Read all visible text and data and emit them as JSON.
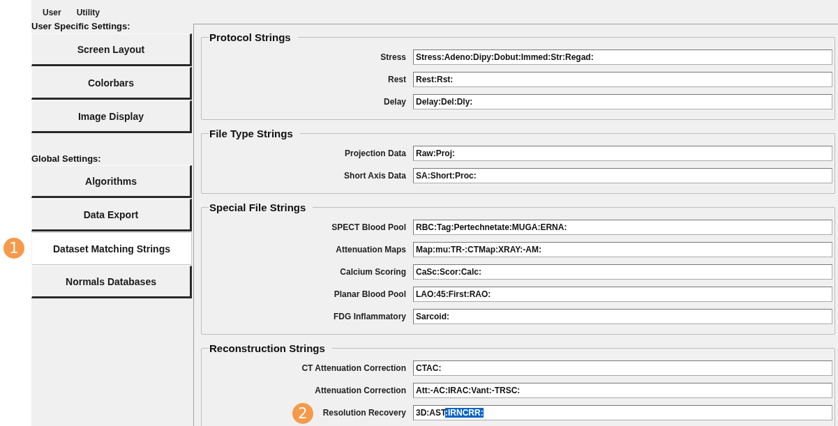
{
  "menu": [
    {
      "label": "User"
    },
    {
      "label": "Utility"
    }
  ],
  "sidebar": {
    "sections": [
      {
        "title": "User Specific Settings:",
        "buttons": [
          {
            "label": "Screen Layout",
            "selected": false
          },
          {
            "label": "Colorbars",
            "selected": false
          },
          {
            "label": "Image Display",
            "selected": false
          }
        ]
      },
      {
        "title": "Global Settings:",
        "buttons": [
          {
            "label": "Algorithms",
            "selected": false
          },
          {
            "label": "Data Export",
            "selected": false
          },
          {
            "label": "Dataset Matching Strings",
            "selected": true,
            "marker": "1"
          },
          {
            "label": "Normals Databases",
            "selected": false
          }
        ]
      }
    ]
  },
  "groups": [
    {
      "title": "Protocol Strings",
      "rows": [
        {
          "label": "Stress",
          "value": "Stress:Adeno:Dipy:Dobut:Immed:Str:Regad:"
        },
        {
          "label": "Rest",
          "value": "Rest:Rst:"
        },
        {
          "label": "Delay",
          "value": "Delay:Del:Dly:"
        }
      ]
    },
    {
      "title": "File Type Strings",
      "rows": [
        {
          "label": "Projection Data",
          "value": "Raw:Proj:"
        },
        {
          "label": "Short Axis Data",
          "value": "SA:Short:Proc:"
        }
      ]
    },
    {
      "title": "Special File Strings",
      "rows": [
        {
          "label": "SPECT Blood Pool",
          "value": "RBC:Tag:Pertechnetate:MUGA:ERNA:"
        },
        {
          "label": "Attenuation Maps",
          "value": "Map:mu:TR-:CTMap:XRAY:-AM:"
        },
        {
          "label": "Calcium Scoring",
          "value": "CaSc:Scor:Calc:"
        },
        {
          "label": "Planar Blood Pool",
          "value": "LAO:45:First:RAO:"
        },
        {
          "label": "FDG Inflammatory",
          "value": "Sarcoid:"
        }
      ]
    },
    {
      "title": "Reconstruction Strings",
      "rows": [
        {
          "label": "CT Attenuation Correction",
          "value": "CTAC:"
        },
        {
          "label": "Attenuation Correction",
          "value": "Att:-AC:IRAC:Vant:-TRSC:"
        },
        {
          "label": "Resolution Recovery",
          "value": "3D:AST",
          "selection": ":IRNCRR:",
          "marker": "2"
        }
      ]
    }
  ]
}
